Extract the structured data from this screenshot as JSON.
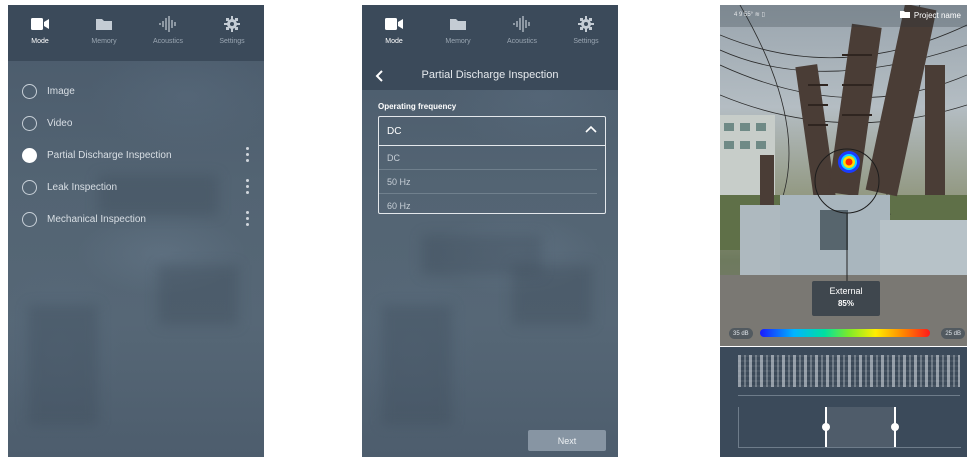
{
  "tabs": [
    {
      "label": "Mode",
      "icon": "camera-icon"
    },
    {
      "label": "Memory",
      "icon": "folder-icon"
    },
    {
      "label": "Acoustics",
      "icon": "waveform-icon"
    },
    {
      "label": "Settings",
      "icon": "gear-icon"
    }
  ],
  "screen1": {
    "modes": [
      {
        "label": "Image",
        "selected": false,
        "menu": false
      },
      {
        "label": "Video",
        "selected": false,
        "menu": false
      },
      {
        "label": "Partial Discharge Inspection",
        "selected": true,
        "menu": true
      },
      {
        "label": "Leak Inspection",
        "selected": false,
        "menu": true
      },
      {
        "label": "Mechanical Inspection",
        "selected": false,
        "menu": true
      }
    ]
  },
  "screen2": {
    "title": "Partial Discharge Inspection",
    "field_label": "Operating frequency",
    "selected": "DC",
    "options": [
      "DC",
      "50 Hz",
      "60 Hz"
    ],
    "next_label": "Next"
  },
  "screen3": {
    "project_label": "Project name",
    "status_text": "4 9 55° ≋ ▯",
    "callout_title": "External",
    "callout_value": "85%",
    "scale_min": "35 dB",
    "scale_max": "25 dB",
    "colors": {
      "bg": "#3b4a5a",
      "accent": "#ffffff"
    }
  }
}
